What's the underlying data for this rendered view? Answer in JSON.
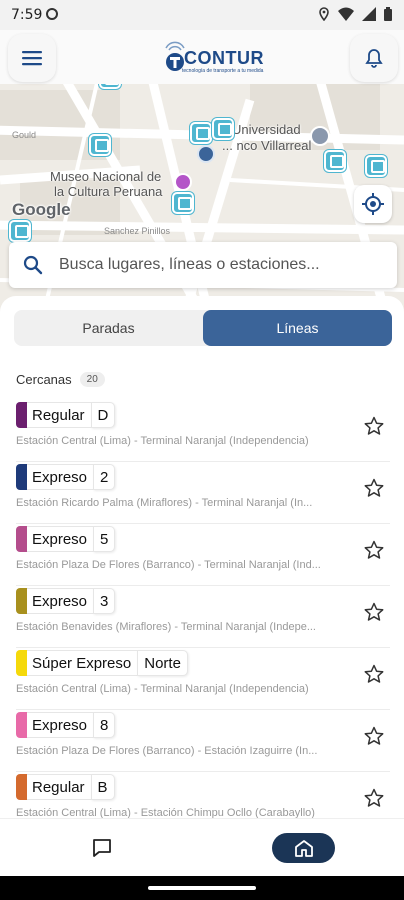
{
  "status_bar": {
    "time": "7:59",
    "icons": [
      "location-icon",
      "wifi-icon",
      "signal-icon",
      "battery-icon"
    ]
  },
  "header": {
    "menu_icon": "menu-icon",
    "logo_text": "CONTUR",
    "logo_tagline": "tecnología de transporte a tu medida",
    "bell_icon": "bell-icon"
  },
  "map": {
    "places": [
      "Universidad",
      "... nco Villarreal",
      "Museo Nacional de",
      "la Cultura Peruana"
    ],
    "streets": [
      "Gould",
      "Sanchez Pinillos"
    ],
    "attribution": "Google"
  },
  "search": {
    "placeholder": "Busca lugares, líneas o estaciones..."
  },
  "tabs": [
    {
      "label": "Paradas",
      "active": false
    },
    {
      "label": "Líneas",
      "active": true
    }
  ],
  "nearby": {
    "title": "Cercanas",
    "count": "20"
  },
  "routes": [
    {
      "type": "Regular",
      "code": "D",
      "color": "#6b1f6e",
      "route": "Estación Central (Lima) - Terminal Naranjal (Independencia)"
    },
    {
      "type": "Expreso",
      "code": "2",
      "color": "#1e3a7a",
      "route": "Estación Ricardo Palma (Miraflores) - Terminal Naranjal (In..."
    },
    {
      "type": "Expreso",
      "code": "5",
      "color": "#b44d8c",
      "route": "Estación Plaza De Flores (Barranco) - Terminal Naranjal (Ind..."
    },
    {
      "type": "Expreso",
      "code": "3",
      "color": "#a8901e",
      "route": "Estación Benavides (Miraflores) - Terminal Naranjal (Indepe..."
    },
    {
      "type": "Súper Expreso",
      "code": "Norte",
      "color": "#f5d90a",
      "route": "Estación Central (Lima) - Terminal Naranjal (Independencia)"
    },
    {
      "type": "Expreso",
      "code": "8",
      "color": "#e86aa8",
      "route": "Estación Plaza De Flores (Barranco) - Estación Izaguirre (In..."
    },
    {
      "type": "Regular",
      "code": "B",
      "color": "#d46a2e",
      "route": "Estación Central (Lima) - Estación Chimpu Ocllo (Carabayllo)"
    }
  ],
  "bottom_nav": {
    "chat_icon": "chat-icon",
    "home_icon": "home-icon"
  }
}
